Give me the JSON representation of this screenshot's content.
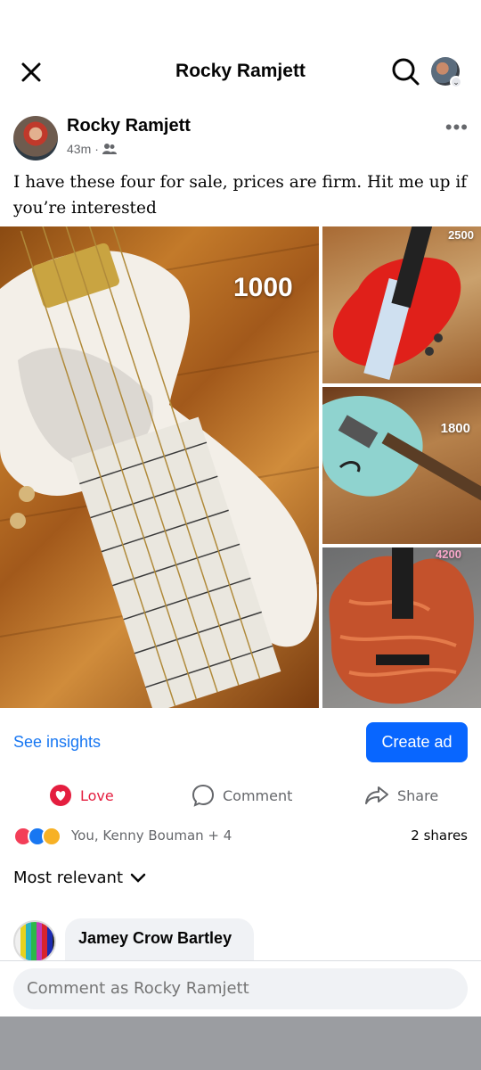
{
  "topbar": {
    "title": "Rocky Ramjett"
  },
  "post": {
    "author": "Rocky Ramjett",
    "time": "43m",
    "separator": "·",
    "text": "I have these four for sale, prices are firm. Hit me up if you’re interested",
    "photos": [
      {
        "price": "1000",
        "subject": "white bass guitar"
      },
      {
        "price": "2500",
        "subject": "red bass guitar"
      },
      {
        "price": "1800",
        "subject": "light blue bass guitar"
      },
      {
        "price": "4200",
        "subject": "quilted orange bass guitar"
      }
    ]
  },
  "actions": {
    "insights": "See insights",
    "create_ad": "Create ad"
  },
  "buttons": {
    "love": "Love",
    "comment": "Comment",
    "share": "Share"
  },
  "summary": {
    "people": "You, Kenny Bouman + 4",
    "shares": "2 shares"
  },
  "sort": {
    "label": "Most relevant"
  },
  "comment": {
    "author": "Jamey Crow Bartley"
  },
  "composer": {
    "placeholder": "Comment as Rocky Ramjett"
  },
  "colors": {
    "accent": "#0866ff",
    "link": "#1877f2",
    "love": "#e41e3f"
  },
  "icons": [
    "close-icon",
    "search-icon",
    "heart-icon",
    "comment-icon",
    "share-icon",
    "chevron-down-icon",
    "friends-icon",
    "more-icon"
  ]
}
